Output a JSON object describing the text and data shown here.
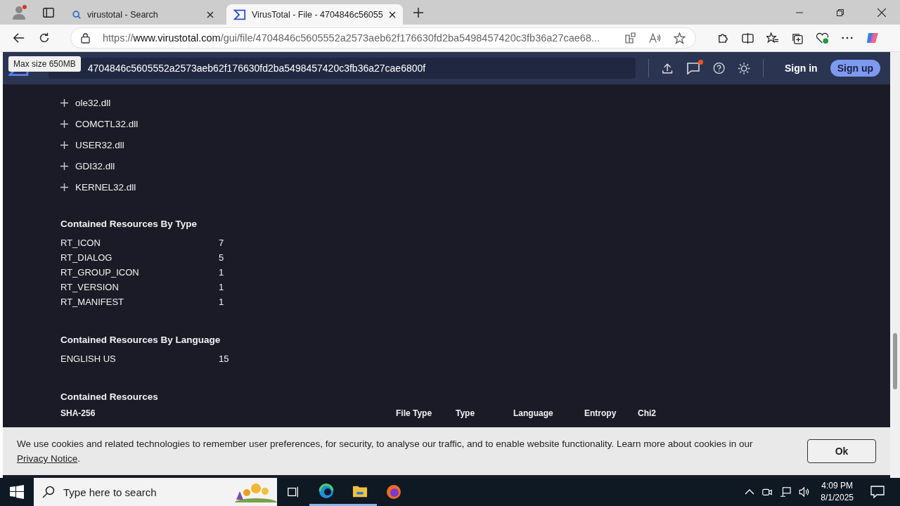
{
  "browser": {
    "tabs": [
      {
        "title": "virustotal - Search",
        "kind": "search",
        "selected": false
      },
      {
        "title": "VirusTotal - File - 4704846c56055",
        "kind": "site",
        "selected": true
      }
    ],
    "url": {
      "host": "https://www.virustotal.com",
      "path": "/gui/file/4704846c5605552a2573aeb62f176630fd2ba5498457420c3fb36a27cae68..."
    }
  },
  "header": {
    "search_value": "4704846c5605552a2573aeb62f176630fd2ba5498457420c3fb36a27cae6800f",
    "tooltip": "Max size 650MB",
    "sign_in": "Sign in",
    "sign_up": "Sign up",
    "notification": true
  },
  "imports": [
    {
      "name": "ole32.dll",
      "expanded": false
    },
    {
      "name": "COMCTL32.dll",
      "expanded": false
    },
    {
      "name": "USER32.dll",
      "expanded": false
    },
    {
      "name": "GDI32.dll",
      "expanded": false
    },
    {
      "name": "KERNEL32.dll",
      "expanded": false
    }
  ],
  "resources_by_type": {
    "title": "Contained Resources By Type",
    "rows": [
      {
        "label": "RT_ICON",
        "count": "7"
      },
      {
        "label": "RT_DIALOG",
        "count": "5"
      },
      {
        "label": "RT_GROUP_ICON",
        "count": "1"
      },
      {
        "label": "RT_VERSION",
        "count": "1"
      },
      {
        "label": "RT_MANIFEST",
        "count": "1"
      }
    ]
  },
  "resources_by_language": {
    "title": "Contained Resources By Language",
    "rows": [
      {
        "label": "ENGLISH US",
        "count": "15"
      }
    ]
  },
  "resources": {
    "title": "Contained Resources",
    "columns": [
      "SHA-256",
      "File Type",
      "Type",
      "Language",
      "Entropy",
      "Chi2"
    ]
  },
  "cookie_banner": {
    "text": "We use cookies and related technologies to remember user preferences, for security, to analyse our traffic, and to enable website functionality. Learn more about cookies in our ",
    "link": "Privacy Notice",
    "end": ".",
    "button": "Ok"
  },
  "taskbar": {
    "search_placeholder": "Type here to search",
    "time": "4:09 PM",
    "date": "8/1/2025"
  }
}
